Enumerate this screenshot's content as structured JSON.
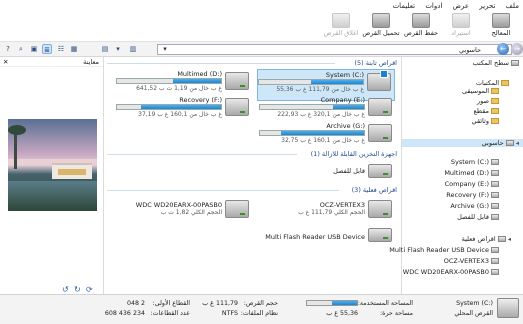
{
  "menu": [
    "ملف",
    "تحرير",
    "عرض",
    "ادوات",
    "تعليمات"
  ],
  "ribbon": {
    "buttons": [
      {
        "label": "المعالج",
        "enabled": true
      },
      {
        "label": "استيراد",
        "enabled": false
      },
      {
        "label": "حفظ القرص",
        "enabled": true
      },
      {
        "label": "تحميل القرص",
        "enabled": true
      },
      {
        "label": "اغلاق القرص",
        "enabled": false
      }
    ]
  },
  "address": {
    "text": "حاسوبي"
  },
  "preview": {
    "header": "معاينة"
  },
  "groups": {
    "fixed": "اقراص ثابتة (5)",
    "removable": "اجهزة التخزين القابلة للازالة (1)",
    "physical": "اقراص فعلية (3)"
  },
  "drives": [
    {
      "name": "System (C:)",
      "free": "55,36 غ ب خال من 111,79 غ ب",
      "fill": 0.5,
      "win": true,
      "selected": true
    },
    {
      "name": "Multimed (D:)",
      "free": "641,52 غ ب خال من 1,19 ت ب",
      "fill": 0.46,
      "win": false,
      "selected": false
    },
    {
      "name": "Company (E:)",
      "free": "222,93 غ ب خال من 320,1 غ ب",
      "fill": 0.3,
      "win": false,
      "selected": false
    },
    {
      "name": "Recovery (F:)",
      "free": "37,19 غ ب خال من 160,1 غ ب",
      "fill": 0.77,
      "win": false,
      "selected": false
    },
    {
      "name": "Archive (G:)",
      "free": "32,75 غ ب خال من 160,1 غ ب",
      "fill": 0.8,
      "win": false,
      "selected": false
    }
  ],
  "removable": [
    {
      "name": "قابل للفصل"
    }
  ],
  "physical": [
    {
      "name": "OCZ-VERTEX3",
      "size": "الحجم الكلي 111,79 غ ب"
    },
    {
      "name": "WDC WD20EARX-00PASB0",
      "size": "الحجم الكلي 1,82 ت ب"
    },
    {
      "name": "Multi Flash Reader USB Device",
      "size": ""
    }
  ],
  "nav": {
    "desktop": "سطح المكتب",
    "libraries": "المكتبات",
    "lib_items": [
      "الموسيقى",
      "صور",
      "مقطع",
      "وثائقي"
    ],
    "computer": "حاسوبي",
    "drives": [
      "System (C:)",
      "Multimed (D:)",
      "Company (E:)",
      "Recovery (F:)",
      "Archive (G:)",
      "قابل للفصل"
    ],
    "physical_title": "اقراص فعلية",
    "physical": [
      "Multi Flash Reader USB Device",
      "OCZ-VERTEX3",
      "WDC WD20EARX-00PASB0"
    ]
  },
  "status": {
    "drive": "System (C:)",
    "type": "القرص المحلي",
    "used_label": "المساحة المستخدمة:",
    "free_label": "مساحة حرة:",
    "free": "55,36 غ ب",
    "size_label": "حجم القرص:",
    "size": "111,79 غ ب",
    "fs_label": "نظام الملفات:",
    "fs": "NTFS",
    "sector_label": "القطاع الأولى:",
    "sector": "2 048",
    "count_label": "عدد القطاعات:",
    "count": "234 436 608",
    "used_fill": 0.5
  }
}
